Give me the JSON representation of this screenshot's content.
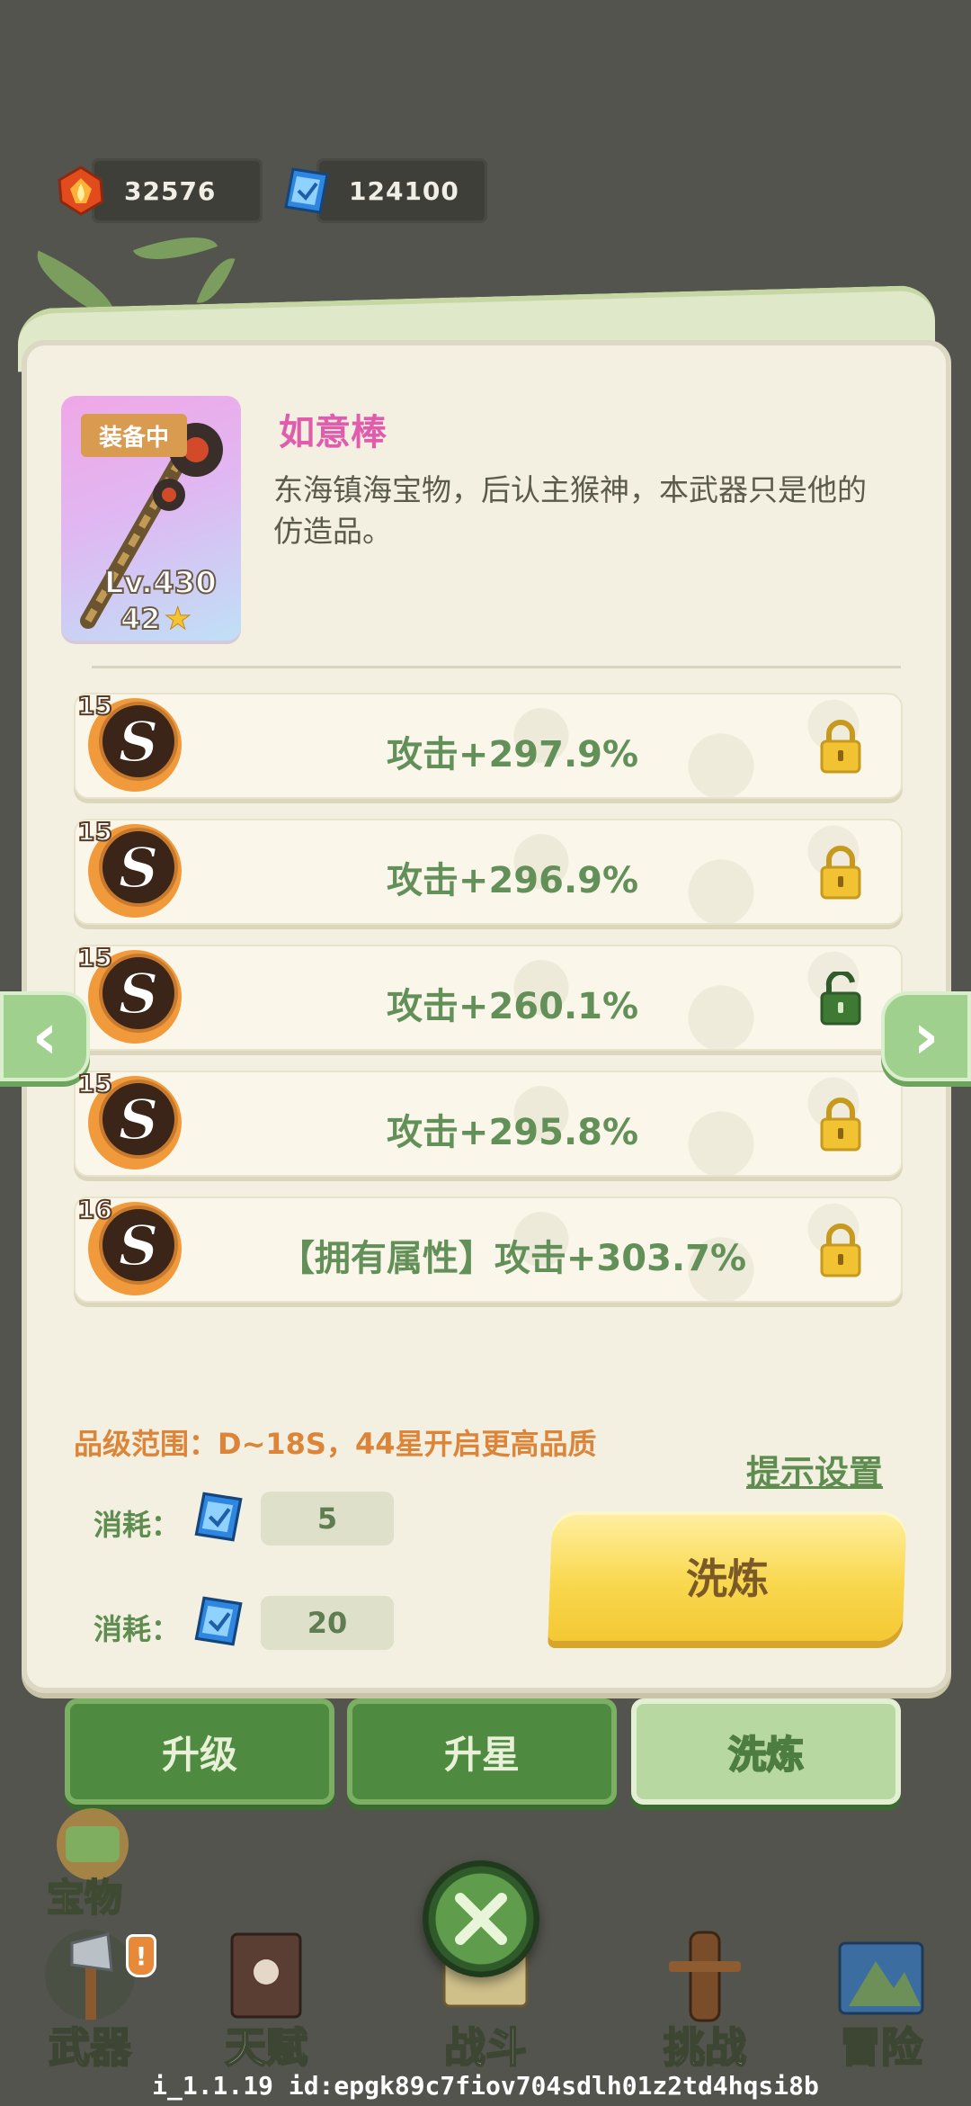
{
  "currency": {
    "gem": {
      "icon": "fire-gem-icon",
      "amount": "32576"
    },
    "diamond": {
      "icon": "blue-diamond-icon",
      "amount": "124100"
    }
  },
  "weapon": {
    "equipped_badge": "装备中",
    "level": "Lv.430",
    "stars": "42",
    "name": "如意棒",
    "description": "东海镇海宝物，后认主猴神，本武器只是他的仿造品。"
  },
  "attributes": [
    {
      "grade": "15",
      "rank": "S",
      "text": "攻击+297.9%",
      "locked": true
    },
    {
      "grade": "15",
      "rank": "S",
      "text": "攻击+296.9%",
      "locked": true
    },
    {
      "grade": "15",
      "rank": "S",
      "text": "攻击+260.1%",
      "locked": false
    },
    {
      "grade": "15",
      "rank": "S",
      "text": "攻击+295.8%",
      "locked": true
    },
    {
      "grade": "16",
      "rank": "S",
      "text": "【拥有属性】攻击+303.7%",
      "locked": true
    }
  ],
  "grade_range": "品级范围：D~18S，44星开启更高品质",
  "hint_settings": "提示设置",
  "costs": [
    {
      "label": "消耗：",
      "value": "5"
    },
    {
      "label": "消耗：",
      "value": "20"
    }
  ],
  "wash_button": "洗炼",
  "tabs": [
    {
      "label": "升级"
    },
    {
      "label": "升星"
    },
    {
      "label": "洗炼",
      "active": true
    }
  ],
  "side_treasure": "宝物",
  "nav": [
    {
      "label": "武器",
      "icon": "axe-icon"
    },
    {
      "label": "天赋",
      "icon": "book-icon"
    },
    {
      "label": "战斗",
      "icon": "scroll-icon"
    },
    {
      "label": "挑战",
      "icon": "wooden-dummy-icon"
    },
    {
      "label": "冒险",
      "icon": "map-icon"
    }
  ],
  "nav_alert": "!",
  "debug_text": "i_1.1.19 id:epgk89c7fiov704sdlh01z2td4hqsi8b",
  "colors": {
    "accent_green": "#639058",
    "name_pink": "#e05cad",
    "orange_text": "#dc8438",
    "button_yellow": "#f9d84f"
  }
}
